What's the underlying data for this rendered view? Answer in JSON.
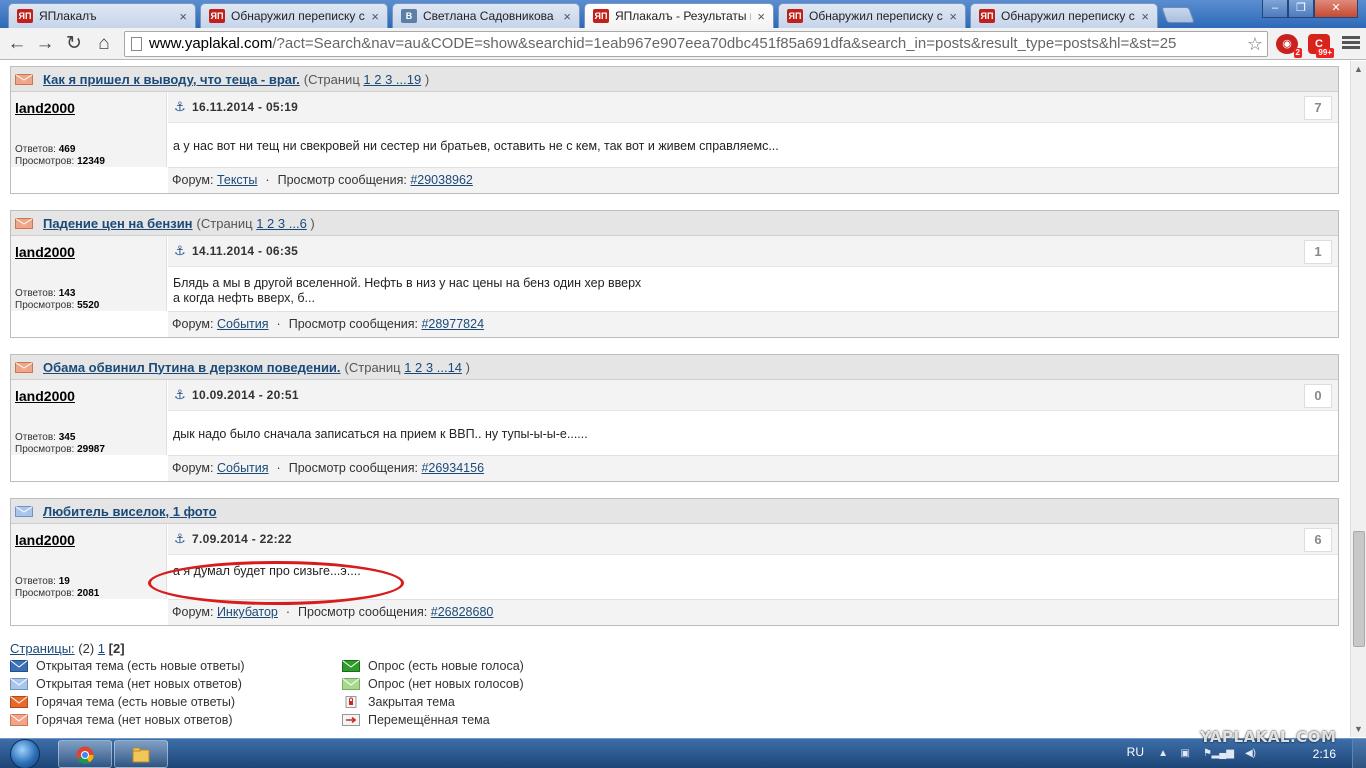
{
  "browser": {
    "tabs": [
      {
        "title": "ЯПлакалъ",
        "icon": "yap",
        "active": false
      },
      {
        "title": "Обнаружил переписку с",
        "icon": "yap",
        "active": false
      },
      {
        "title": "Светлана Садовникова | ",
        "icon": "vk",
        "active": false
      },
      {
        "title": "ЯПлакалъ - Результаты п",
        "icon": "yap",
        "active": true
      },
      {
        "title": "Обнаружил переписку с",
        "icon": "yap",
        "active": false
      },
      {
        "title": "Обнаружил переписку с",
        "icon": "yap",
        "active": false
      }
    ],
    "favicon_yap": "ЯП",
    "favicon_vk": "В",
    "url_host": "www.yaplakal.com",
    "url_rest": "/?act=Search&nav=au&CODE=show&searchid=1eab967e907eea70dbc451f85a691dfa&search_in=posts&result_type=posts&hl=&st=25",
    "ext_badge_1": "2",
    "ext_badge_2": "99+"
  },
  "results": [
    {
      "title": "Как я пришел к выводу, что теща - враг.",
      "pages_prefix": "(Страниц",
      "pages_links": "1 2 3 ...19",
      "pages_suffix": ")",
      "author": "land2000",
      "replies_label": "Ответов:",
      "replies": "469",
      "views_label": "Просмотров:",
      "views": "12349",
      "date": "16.11.2014 - 05:19",
      "number": "7",
      "text": "а у нас вот ни тещ ни свекровей ни сестер ни братьев, оставить не с кем, так вот и живем справляемс...",
      "forum_label": "Форум:",
      "forum": "Тексты",
      "view_label": "Просмотр сообщения:",
      "post_id": "#29038962",
      "icon_color": "#f0a58a"
    },
    {
      "title": "Падение цен на бензин",
      "pages_prefix": "(Страниц",
      "pages_links": "1 2 3 ...6",
      "pages_suffix": ")",
      "author": "land2000",
      "replies_label": "Ответов:",
      "replies": "143",
      "views_label": "Просмотров:",
      "views": "5520",
      "date": "14.11.2014 - 06:35",
      "number": "1",
      "text": "Блядь а мы в другой вселенной. Нефть в низ у нас цены на бенз один хер вверх",
      "text2": "а когда нефть вверх, б...",
      "forum_label": "Форум:",
      "forum": "События",
      "view_label": "Просмотр сообщения:",
      "post_id": "#28977824",
      "icon_color": "#f0a58a"
    },
    {
      "title": "Обама обвинил Путина в дерзком поведении.",
      "pages_prefix": "(Страниц",
      "pages_links": "1 2 3 ...14",
      "pages_suffix": ")",
      "author": "land2000",
      "replies_label": "Ответов:",
      "replies": "345",
      "views_label": "Просмотров:",
      "views": "29987",
      "date": "10.09.2014 - 20:51",
      "number": "0",
      "text": "дык надо было сначала записаться на прием к ВВП.. ну тупы-ы-ы-е......",
      "forum_label": "Форум:",
      "forum": "События",
      "view_label": "Просмотр сообщения:",
      "post_id": "#26934156",
      "icon_color": "#f0a58a"
    },
    {
      "title": "Любитель виселок, 1 фото",
      "author": "land2000",
      "replies_label": "Ответов:",
      "replies": "19",
      "views_label": "Просмотров:",
      "views": "2081",
      "date": "7.09.2014 - 22:22",
      "number": "6",
      "text": "а я думал будет про сизьге...э....",
      "forum_label": "Форум:",
      "forum": "Инкубатор",
      "view_label": "Просмотр сообщения:",
      "post_id": "#26828680",
      "icon_color": "#a9c6ea"
    }
  ],
  "pager": {
    "label": "Страницы:",
    "count": "(2)",
    "page1": "1",
    "current": "[2]"
  },
  "legend_left": [
    {
      "label": "Открытая тема (есть новые ответы)",
      "color": "#3b6fb6"
    },
    {
      "label": "Открытая тема (нет новых ответов)",
      "color": "#a9c6ea"
    },
    {
      "label": "Горячая тема (есть новые ответы)",
      "color": "#e8692e"
    },
    {
      "label": "Горячая тема (нет новых ответов)",
      "color": "#f0a58a"
    }
  ],
  "legend_right": [
    {
      "label": "Опрос (есть новые голоса)",
      "color": "#2f9b2a"
    },
    {
      "label": "Опрос (нет новых голосов)",
      "color": "#a6d88e"
    },
    {
      "label": "Закрытая тема",
      "color": "#c62b2b"
    },
    {
      "label": "Перемещённая тема",
      "color": "#c62b2b"
    }
  ],
  "taskbar": {
    "lang": "RU",
    "time": "2:16"
  },
  "watermark": "YAPLAKAL.COM"
}
